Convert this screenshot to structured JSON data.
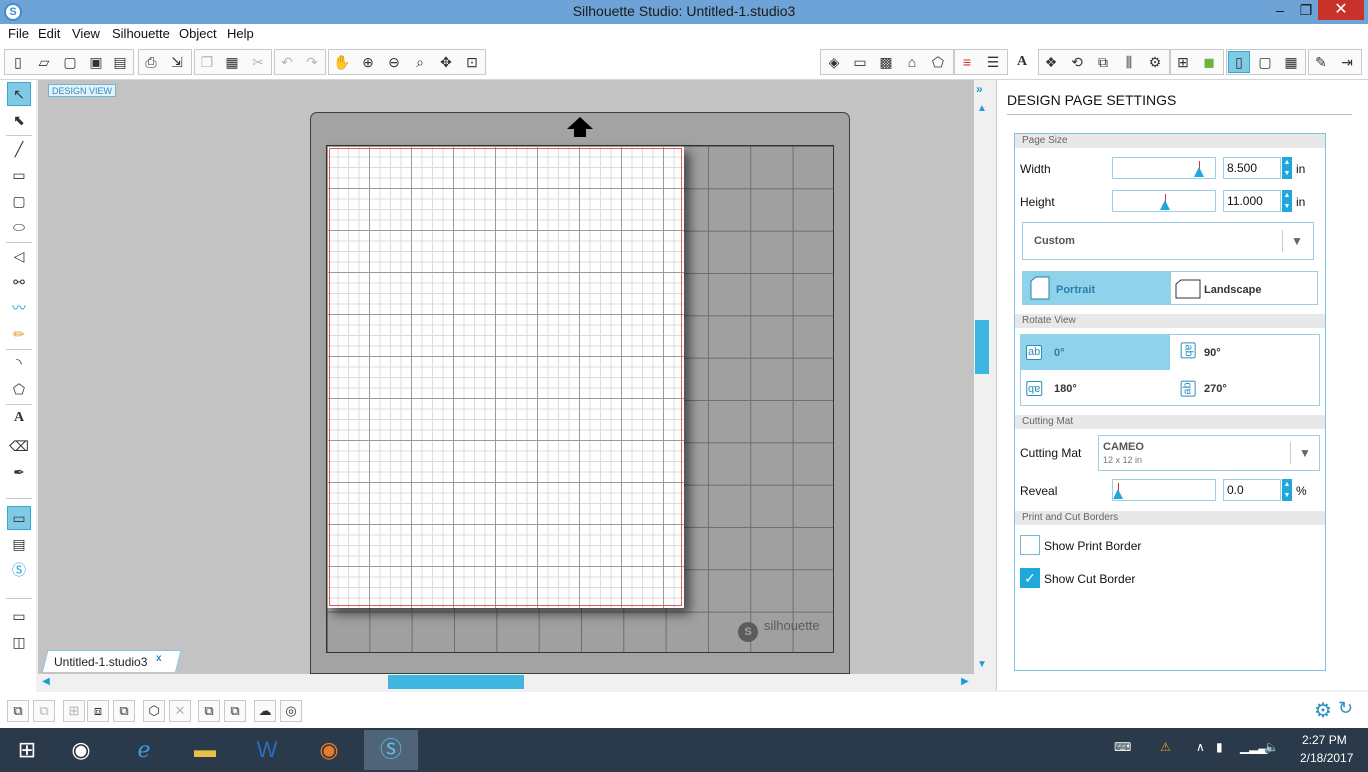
{
  "window": {
    "title": "Silhouette Studio: Untitled-1.studio3",
    "logo": "S",
    "minimize": "–",
    "maximize": "❐",
    "close": "✕"
  },
  "menu": [
    "File",
    "Edit",
    "View",
    "Silhouette",
    "Object",
    "Help"
  ],
  "toolbar": {
    "left_icons": [
      "new-icon",
      "open-icon",
      "template-icon",
      "save-icon",
      "save-library-icon",
      "print-icon",
      "send-icon",
      "copy-icon",
      "paste-icon",
      "cut-icon",
      "undo-icon",
      "redo-icon",
      "pan-icon",
      "zoom-in-icon",
      "zoom-out-icon",
      "zoom-select-icon",
      "drag-zoom-icon",
      "fit-page-icon"
    ],
    "right_icons": [
      "fill-icon",
      "line-color-icon",
      "fill-pattern-icon",
      "shadow-icon",
      "line-style-icon",
      "line-width-icon",
      "text-style-icon",
      "text-icon",
      "replicate-icon",
      "transform-icon",
      "align-icon",
      "offset-icon",
      "trace-icon",
      "modify-icon",
      "library-icon",
      "store-icon",
      "design-page-icon",
      "registration-icon",
      "grid-icon",
      "cut-settings-icon",
      "send-to-cutter-icon"
    ]
  },
  "canvas": {
    "design_view_label": "DESIGN VIEW",
    "mat_brand": "silhouette",
    "mat_brand_logo": "S"
  },
  "doc_tab": {
    "label": "Untitled-1.studio3",
    "close": "x"
  },
  "panel": {
    "title": "DESIGN PAGE SETTINGS",
    "sections": {
      "page_size": "Page Size",
      "rotate_view": "Rotate View",
      "cutting_mat": "Cutting Mat",
      "print_cut_borders": "Print and Cut Borders"
    },
    "width": {
      "label": "Width",
      "value": "8.500",
      "unit": "in"
    },
    "height": {
      "label": "Height",
      "value": "11.000",
      "unit": "in"
    },
    "page_preset": "Custom",
    "orientation": {
      "portrait": "Portrait",
      "landscape": "Landscape",
      "selected": "portrait"
    },
    "rotate": {
      "r0": "0°",
      "r90": "90°",
      "r180": "180°",
      "r270": "270°",
      "selected": "0°"
    },
    "mat": {
      "label": "Cutting Mat",
      "value": "CAMEO",
      "sub": "12 x 12 in"
    },
    "reveal": {
      "label": "Reveal",
      "value": "0.0",
      "unit": "%"
    },
    "show_print_border": {
      "label": "Show Print Border",
      "checked": false
    },
    "show_cut_border": {
      "label": "Show Cut Border",
      "checked": true
    }
  },
  "taskbar": {
    "time": "2:27 PM",
    "date": "2/18/2017",
    "apps": [
      "windows-start-icon",
      "chrome-icon",
      "internet-explorer-icon",
      "file-explorer-icon",
      "word-icon",
      "firefox-icon",
      "silhouette-studio-icon"
    ]
  },
  "colors": {
    "accent": "#1fa8db",
    "titlebar": "#6ea3d8",
    "taskbar": "#2b3a4a"
  }
}
